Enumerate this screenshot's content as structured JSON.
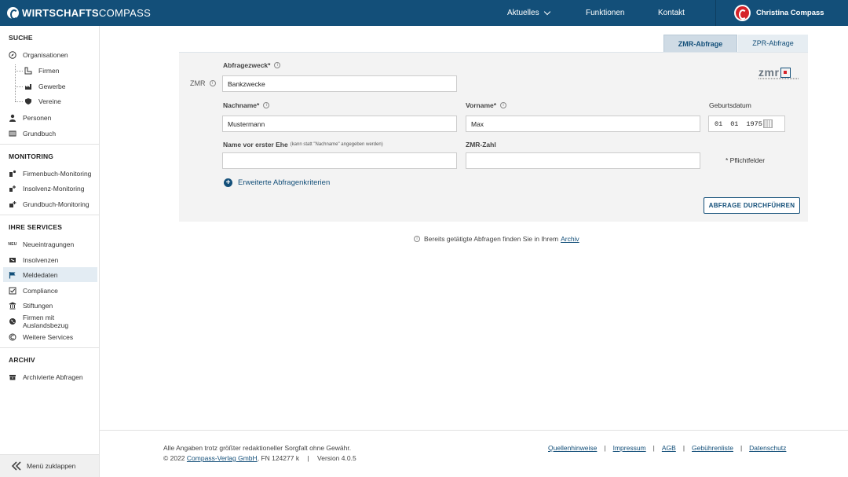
{
  "header": {
    "logo_bold": "WIRTSCHAFTS",
    "logo_light": "COMPASS",
    "nav": {
      "aktuelles": "Aktuelles",
      "funktionen": "Funktionen",
      "kontakt": "Kontakt"
    },
    "user_name": "Christina Compass"
  },
  "sidebar": {
    "sections": {
      "suche": "SUCHE",
      "monitoring": "MONITORING",
      "services": "IHRE SERVICES",
      "archiv": "ARCHIV"
    },
    "suche_items": {
      "organisationen": "Organisationen",
      "firmen": "Firmen",
      "gewerbe": "Gewerbe",
      "vereine": "Vereine",
      "personen": "Personen",
      "grundbuch": "Grundbuch"
    },
    "monitoring_items": {
      "firmenbuch": "Firmenbuch-Monitoring",
      "insolvenz": "Insolvenz-Monitoring",
      "grundbuch": "Grundbuch-Monitoring"
    },
    "services_items": {
      "neu_badge": "NEU",
      "neueintragungen": "Neueintragungen",
      "insolvenzen": "Insolvenzen",
      "meldedaten": "Meldedaten",
      "compliance": "Compliance",
      "stiftungen": "Stiftungen",
      "ausland": "Firmen mit Auslandsbezug",
      "weitere": "Weitere Services"
    },
    "archiv_items": {
      "archivierte": "Archivierte Abfragen"
    },
    "collapse_label": "Menü zuklappen"
  },
  "tabs": {
    "zmr": "ZMR-Abfrage",
    "zpr": "ZPR-Abfrage",
    "active": "zmr"
  },
  "form": {
    "zmr_side_label": "ZMR",
    "abfragezweck": {
      "label": "Abfragezweck*",
      "value": "Bankzwecke"
    },
    "nachname": {
      "label": "Nachname*",
      "value": "Mustermann"
    },
    "vorname": {
      "label": "Vorname*",
      "value": "Max"
    },
    "geburtsdatum": {
      "label": "Geburtsdatum",
      "day": "01",
      "month": "01",
      "year": "1975"
    },
    "name_vor_ehe": {
      "label": "Name vor erster Ehe",
      "hint": "(kann statt \"Nachname\" angegeben werden)",
      "value": ""
    },
    "zmr_zahl": {
      "label": "ZMR-Zahl",
      "value": ""
    },
    "pflicht_note": "* Pflichtfelder",
    "erweitert_label": "Erweiterte Abfragenkriterien",
    "submit_label": "ABFRAGE DURCHFÜHREN",
    "zmr_logo": "zmr"
  },
  "archive_note": {
    "text": "Bereits getätigte Abfragen finden Sie in Ihrem",
    "link": "Archiv"
  },
  "footer": {
    "disclaimer": "Alle Angaben trotz größter redaktioneller Sorgfalt ohne Gewähr.",
    "copyright_prefix": "© 2022",
    "company_link": "Compass-Verlag GmbH",
    "fn": ", FN 124277 k",
    "version": "Version 4.0.5",
    "links": {
      "quellen": "Quellenhinweise",
      "impressum": "Impressum",
      "agb": "AGB",
      "gebuehren": "Gebührenliste",
      "datenschutz": "Datenschutz"
    }
  },
  "colors": {
    "primary": "#134f79",
    "accent": "#d6232a",
    "panel": "#f3f3f3"
  }
}
